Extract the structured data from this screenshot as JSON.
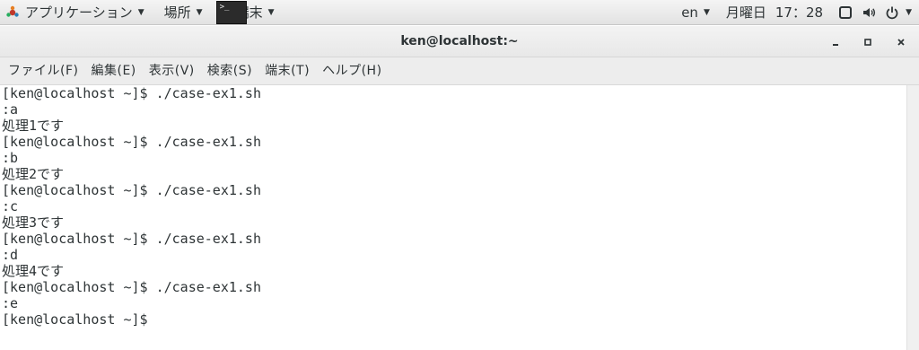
{
  "topbar": {
    "applications_label": "アプリケーション",
    "places_label": "場所",
    "active_app_label": "端末",
    "input_method": "en",
    "date_label": "月曜日",
    "time_label": "17：28"
  },
  "window": {
    "title": "ken@localhost:~"
  },
  "menu": {
    "items": [
      "ファイル(F)",
      "編集(E)",
      "表示(V)",
      "検索(S)",
      "端末(T)",
      "ヘルプ(H)"
    ]
  },
  "terminal": {
    "lines": [
      "[ken@localhost ~]$ ./case-ex1.sh",
      ":a",
      "処理1です",
      "[ken@localhost ~]$ ./case-ex1.sh",
      ":b",
      "処理2です",
      "[ken@localhost ~]$ ./case-ex1.sh",
      ":c",
      "処理3です",
      "[ken@localhost ~]$ ./case-ex1.sh",
      ":d",
      "処理4です",
      "[ken@localhost ~]$ ./case-ex1.sh",
      ":e",
      "[ken@localhost ~]$"
    ]
  }
}
